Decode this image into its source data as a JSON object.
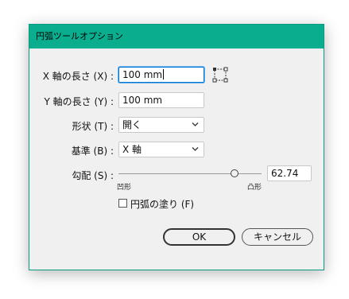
{
  "dialog": {
    "title": "円弧ツールオプション"
  },
  "fields": {
    "x_length_label": "X 軸の長さ (X) :",
    "x_length_value": "100 mm",
    "y_length_label": "Y 軸の長さ (Y) :",
    "y_length_value": "100 mm",
    "type_label": "形状 (T) :",
    "type_value": "開く",
    "base_label": "基準 (B) :",
    "base_value": "X 軸",
    "slope_label": "勾配 (S) :",
    "slope_value": "62.74",
    "slope_fraction": 0.8137,
    "slope_min_label": "凹形",
    "slope_max_label": "凸形",
    "fill_label": "円弧の塗り (F)"
  },
  "buttons": {
    "ok_label": "OK",
    "cancel_label": "キャンセル"
  },
  "colors": {
    "title_bar": "#0aae8f",
    "focus_ring": "#0078d7"
  },
  "icons": {
    "origin": "reference-point-icon",
    "dropdown": "chevron-down-icon"
  }
}
